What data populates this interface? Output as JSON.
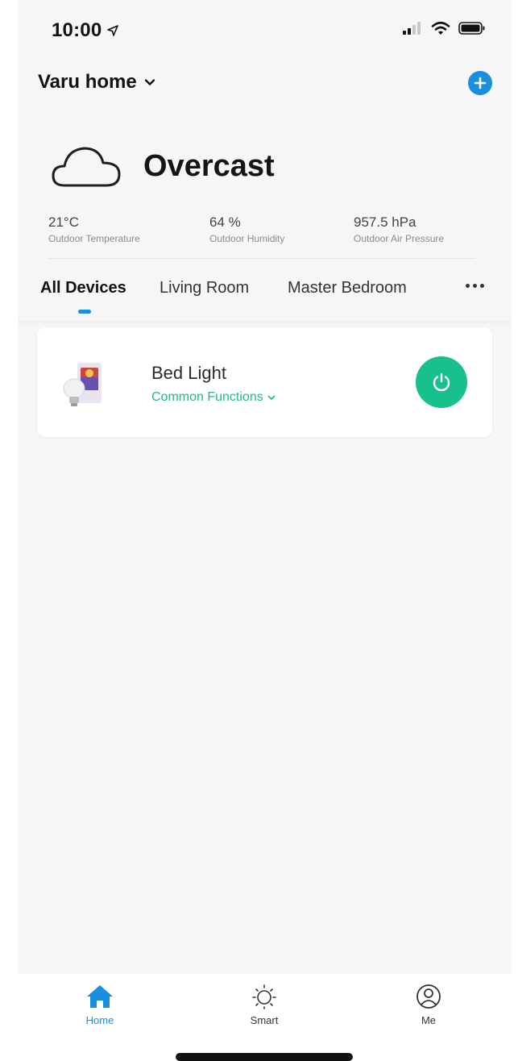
{
  "status_bar": {
    "time": "10:00"
  },
  "header": {
    "home_name": "Varu home"
  },
  "weather": {
    "condition": "Overcast",
    "stats": [
      {
        "value": "21°C",
        "label": "Outdoor Temperature"
      },
      {
        "value": "64 %",
        "label": "Outdoor Humidity"
      },
      {
        "value": "957.5 hPa",
        "label": "Outdoor Air Pressure"
      }
    ]
  },
  "tabs": [
    {
      "label": "All Devices",
      "active": true
    },
    {
      "label": "Living Room",
      "active": false
    },
    {
      "label": "Master Bedroom",
      "active": false
    }
  ],
  "devices": [
    {
      "name": "Bed Light",
      "functions_label": "Common Functions"
    }
  ],
  "bottom_nav": [
    {
      "label": "Home",
      "icon": "home-icon",
      "active": true
    },
    {
      "label": "Smart",
      "icon": "sun-icon",
      "active": false
    },
    {
      "label": "Me",
      "icon": "user-icon",
      "active": false
    }
  ],
  "colors": {
    "accent_blue": "#1a8fe0",
    "accent_green": "#18c08c",
    "background": "#f6f6f6"
  }
}
